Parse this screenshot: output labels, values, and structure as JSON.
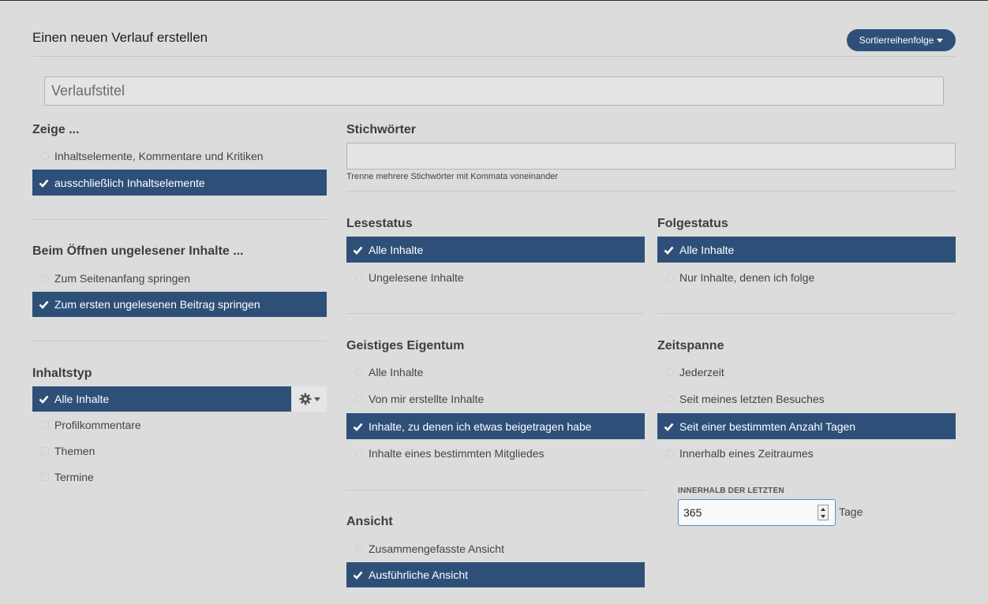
{
  "header": {
    "title": "Einen neuen Verlauf erstellen",
    "sort_label": "Sortierreihenfolge"
  },
  "title_input": {
    "placeholder": "Verlaufstitel"
  },
  "show": {
    "heading": "Zeige ...",
    "options": [
      "Inhaltselemente, Kommentare und Kritiken",
      "ausschließlich Inhaltselemente"
    ],
    "selected": 1
  },
  "open_unread": {
    "heading": "Beim Öffnen ungelesener Inhalte ...",
    "options": [
      "Zum Seitenanfang springen",
      "Zum ersten ungelesenen Beitrag springen"
    ],
    "selected": 1
  },
  "content_type": {
    "heading": "Inhaltstyp",
    "options": [
      "Alle Inhalte",
      "Profilkommentare",
      "Themen",
      "Termine"
    ],
    "selected": 0,
    "settings_icon": "gear-icon"
  },
  "keywords": {
    "heading": "Stichwörter",
    "hint": "Trenne mehrere Stichwörter mit Kommata voneinander"
  },
  "read_status": {
    "heading": "Lesestatus",
    "options": [
      "Alle Inhalte",
      "Ungelesene Inhalte"
    ],
    "selected": 0
  },
  "follow_status": {
    "heading": "Folgestatus",
    "options": [
      "Alle Inhalte",
      "Nur Inhalte, denen ich folge"
    ],
    "selected": 0
  },
  "intellectual_property": {
    "heading": "Geistiges Eigentum",
    "options": [
      "Alle Inhalte",
      "Von mir erstellte Inhalte",
      "Inhalte, zu denen ich etwas beigetragen habe",
      "Inhalte eines bestimmten Mitgliedes"
    ],
    "selected": 2
  },
  "timespan": {
    "heading": "Zeitspanne",
    "options": [
      "Jederzeit",
      "Seit meines letzten Besuches",
      "Seit einer bestimmten Anzahl Tagen",
      "Innerhalb eines Zeitraumes"
    ],
    "selected": 2,
    "within_label": "INNERHALB DER LETZTEN",
    "days_value": "365",
    "days_unit": "Tage"
  },
  "view": {
    "heading": "Ansicht",
    "options": [
      "Zusammengefasste Ansicht",
      "Ausführliche Ansicht"
    ],
    "selected": 1
  },
  "colors": {
    "accent": "#2e5078",
    "background": "#dcdcdc"
  }
}
